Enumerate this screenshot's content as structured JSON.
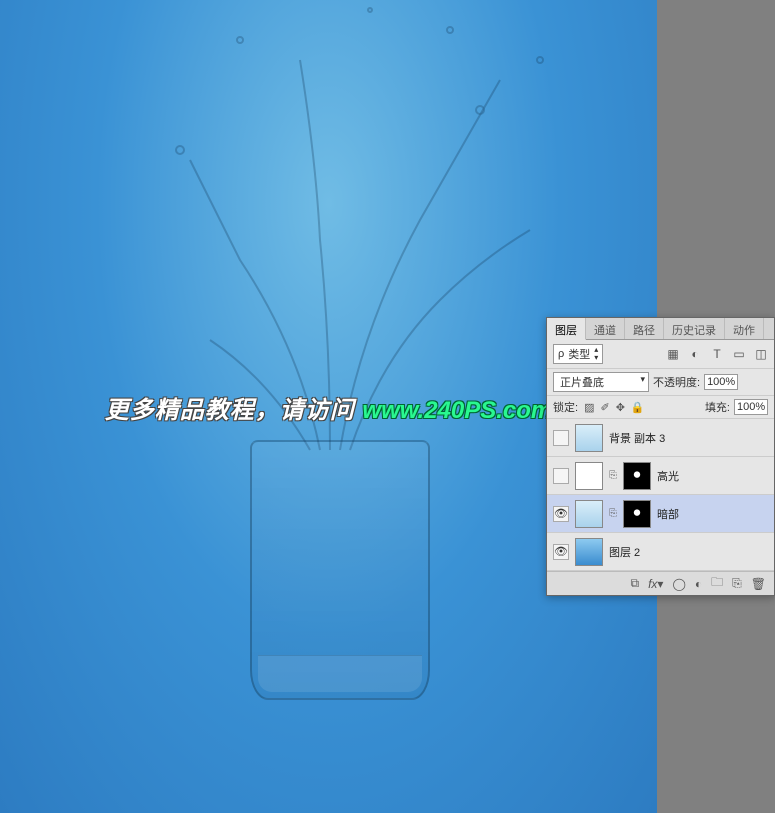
{
  "watermark": {
    "text": "更多精品教程，请访问 ",
    "url": "www.240PS.com"
  },
  "panel": {
    "tabs": [
      "图层",
      "通道",
      "路径",
      "历史记录",
      "动作"
    ],
    "active_tab_index": 0,
    "kind_label": "类型",
    "blend_mode": "正片叠底",
    "opacity_label": "不透明度:",
    "opacity_value": "100%",
    "lock_label": "锁定:",
    "fill_label": "填充:",
    "fill_value": "100%"
  },
  "layers": [
    {
      "visible": false,
      "name": "背景 副本 3",
      "has_mask": false,
      "selected": false,
      "thumb": "splash"
    },
    {
      "visible": false,
      "name": "高光",
      "has_mask": true,
      "mask": "black",
      "selected": false,
      "thumb": "mask-white"
    },
    {
      "visible": true,
      "name": "暗部",
      "has_mask": true,
      "mask": "black",
      "selected": true,
      "thumb": "splash"
    },
    {
      "visible": true,
      "name": "图层 2",
      "has_mask": false,
      "selected": false,
      "thumb": "grad"
    }
  ]
}
